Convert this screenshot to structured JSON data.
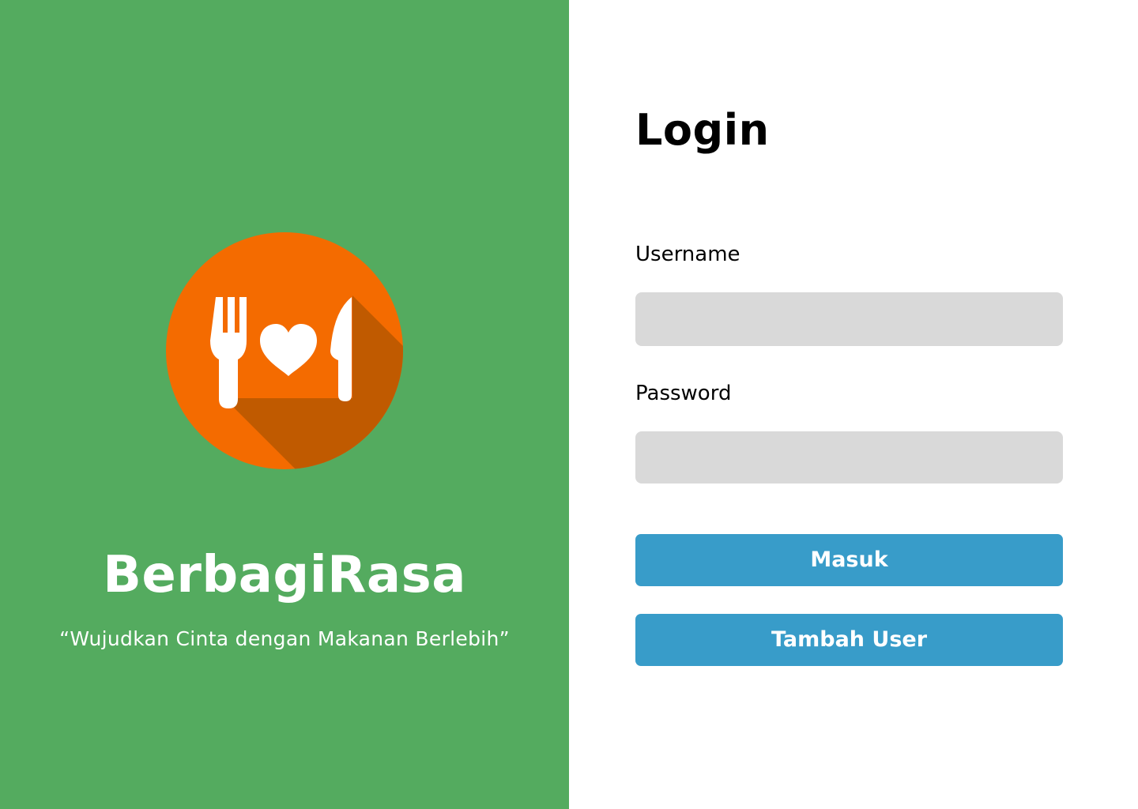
{
  "brand": {
    "name": "BerbagiRasa",
    "tagline": "“Wujudkan Cinta dengan Makanan Berlebih”",
    "logo_icon": "fork-heart-knife-icon"
  },
  "login": {
    "title": "Login",
    "username_label": "Username",
    "username_value": "",
    "password_label": "Password",
    "password_value": "",
    "submit_label": "Masuk",
    "add_user_label": "Tambah User"
  },
  "colors": {
    "left_panel_bg": "#54ab5f",
    "logo_circle": "#f46b00",
    "logo_shadow": "#c05a00",
    "input_bg": "#d9d9d9",
    "button_bg": "#389cc9",
    "text_dark": "#000000",
    "text_light": "#ffffff"
  }
}
